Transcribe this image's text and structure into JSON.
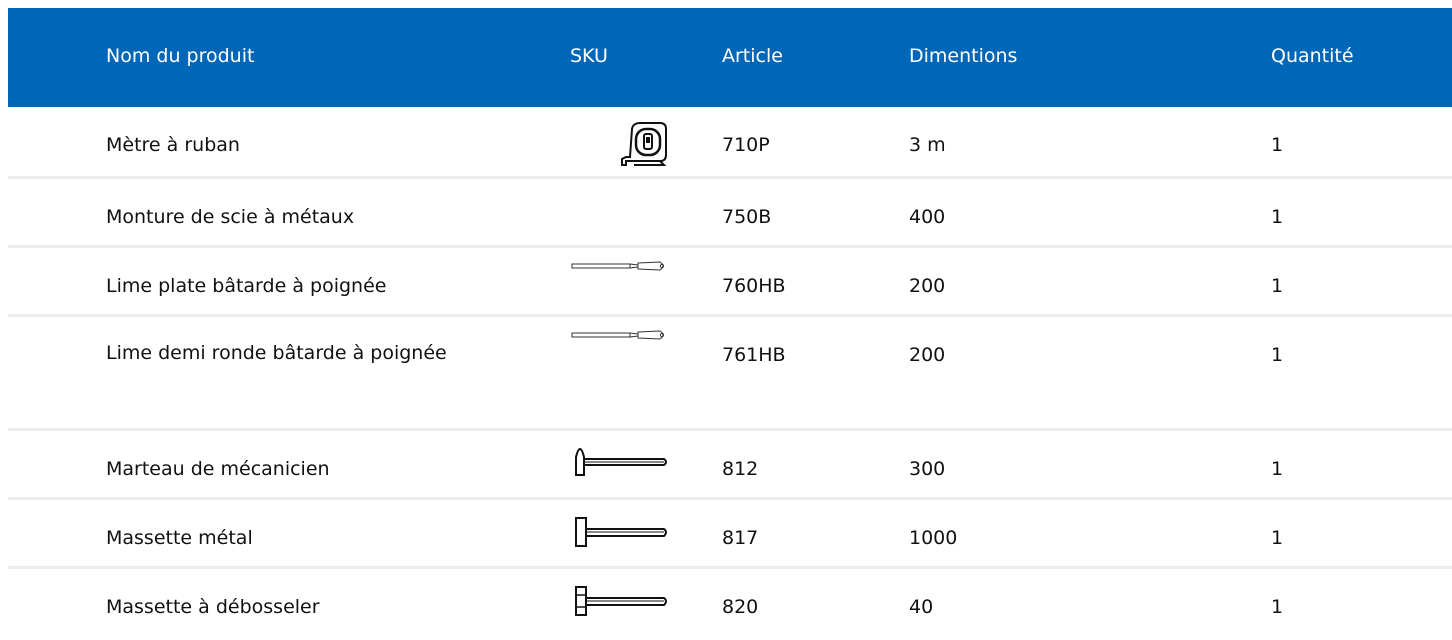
{
  "table": {
    "columns": [
      "Nom du produit",
      "SKU",
      "Article",
      "Dimentions",
      "Quantité"
    ],
    "header_color": "#0067b8",
    "rows": [
      {
        "name": "Mètre à ruban",
        "sku_icon": "tape-measure-icon",
        "article": "710P",
        "dimensions": "3 m",
        "quantity": "1"
      },
      {
        "name": "Monture de scie à métaux",
        "sku_icon": "",
        "article": "750B",
        "dimensions": "400",
        "quantity": "1"
      },
      {
        "name": "Lime plate bâtarde à poignée",
        "sku_icon": "flat-file-icon",
        "article": "760HB",
        "dimensions": "200",
        "quantity": "1"
      },
      {
        "name": "Lime demi ronde bâtarde à poignée",
        "sku_icon": "half-round-file-icon",
        "article": "761HB",
        "dimensions": "200",
        "quantity": "1"
      },
      {
        "name": "Marteau de mécanicien",
        "sku_icon": "machinist-hammer-icon",
        "article": "812",
        "dimensions": "300",
        "quantity": "1"
      },
      {
        "name": "Massette métal",
        "sku_icon": "sledgehammer-icon",
        "article": "817",
        "dimensions": "1000",
        "quantity": "1"
      },
      {
        "name": "Massette à débosseler",
        "sku_icon": "dent-hammer-icon",
        "article": "820",
        "dimensions": "40",
        "quantity": "1"
      }
    ]
  }
}
